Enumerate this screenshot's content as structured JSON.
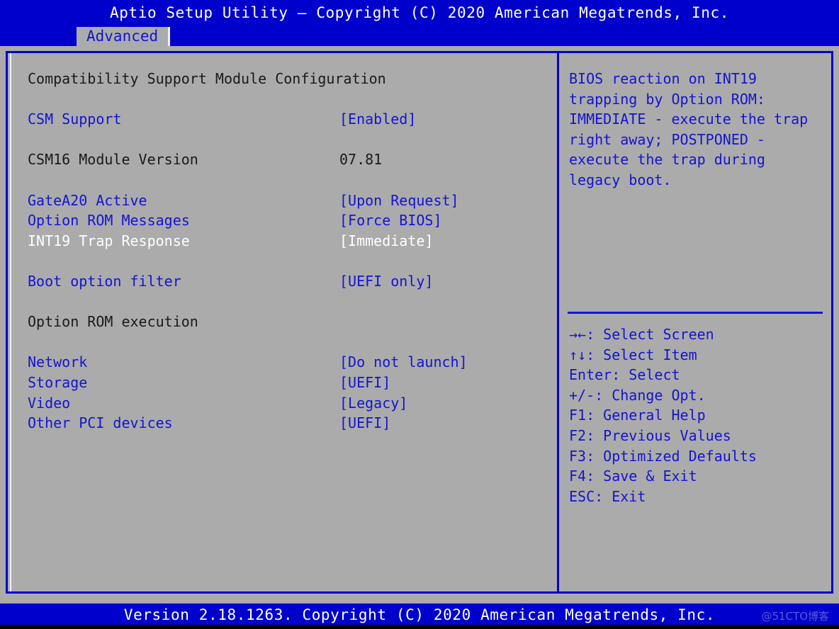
{
  "window": {
    "title": "Aptio Setup Utility – Copyright (C) 2020 American Megatrends, Inc.",
    "footer": "Version 2.18.1263. Copyright (C) 2020 American Megatrends, Inc.",
    "watermark": "@51CTO博客"
  },
  "menu": {
    "active_tab": "Advanced",
    "tabs": [
      "Advanced"
    ]
  },
  "colors": {
    "background": "#ababab",
    "bar_blue": "#0000cc",
    "text_blue": "#1414d2",
    "text_black": "#1a1a1a",
    "text_white": "#ffffff",
    "watermark": "#5a5ae0"
  },
  "main": {
    "section_title": "Compatibility Support Module Configuration",
    "group_title": "Option ROM execution",
    "rows": [
      {
        "label": "CSM Support",
        "value": "[Enabled]",
        "label_color": "blue",
        "value_color": "blue",
        "selected": false
      },
      {
        "label": "CSM16 Module Version",
        "value": "07.81",
        "label_color": "black",
        "value_color": "black",
        "selected": false
      },
      {
        "label": "GateA20 Active",
        "value": "[Upon Request]",
        "label_color": "blue",
        "value_color": "blue",
        "selected": false
      },
      {
        "label": "Option ROM Messages",
        "value": "[Force BIOS]",
        "label_color": "blue",
        "value_color": "blue",
        "selected": false
      },
      {
        "label": "INT19 Trap Response",
        "value": "[Immediate]",
        "label_color": "white",
        "value_color": "white",
        "selected": true
      },
      {
        "label": "Boot option filter",
        "value": "[UEFI only]",
        "label_color": "blue",
        "value_color": "blue",
        "selected": false
      },
      {
        "label": "Network",
        "value": "[Do not launch]",
        "label_color": "blue",
        "value_color": "blue",
        "selected": false
      },
      {
        "label": "Storage",
        "value": "[UEFI]",
        "label_color": "blue",
        "value_color": "blue",
        "selected": false
      },
      {
        "label": "Video",
        "value": "[Legacy]",
        "label_color": "blue",
        "value_color": "blue",
        "selected": false
      },
      {
        "label": "Other PCI devices",
        "value": "[UEFI]",
        "label_color": "blue",
        "value_color": "blue",
        "selected": false
      }
    ]
  },
  "help": {
    "text": "BIOS reaction on INT19 trapping by Option ROM: IMMEDIATE - execute the trap right away; POSTPONED - execute the trap during legacy boot.",
    "legend": [
      {
        "keys": "→←",
        "label": ": Select Screen"
      },
      {
        "keys": "↑↓",
        "label": ": Select Item"
      },
      {
        "keys": "Enter",
        "label": ": Select"
      },
      {
        "keys": "+/-",
        "label": ": Change Opt."
      },
      {
        "keys": "F1",
        "label": ": General Help"
      },
      {
        "keys": "F2",
        "label": ": Previous Values"
      },
      {
        "keys": "F3",
        "label": ": Optimized Defaults"
      },
      {
        "keys": "F4",
        "label": ": Save & Exit"
      },
      {
        "keys": "ESC",
        "label": ": Exit"
      }
    ]
  }
}
